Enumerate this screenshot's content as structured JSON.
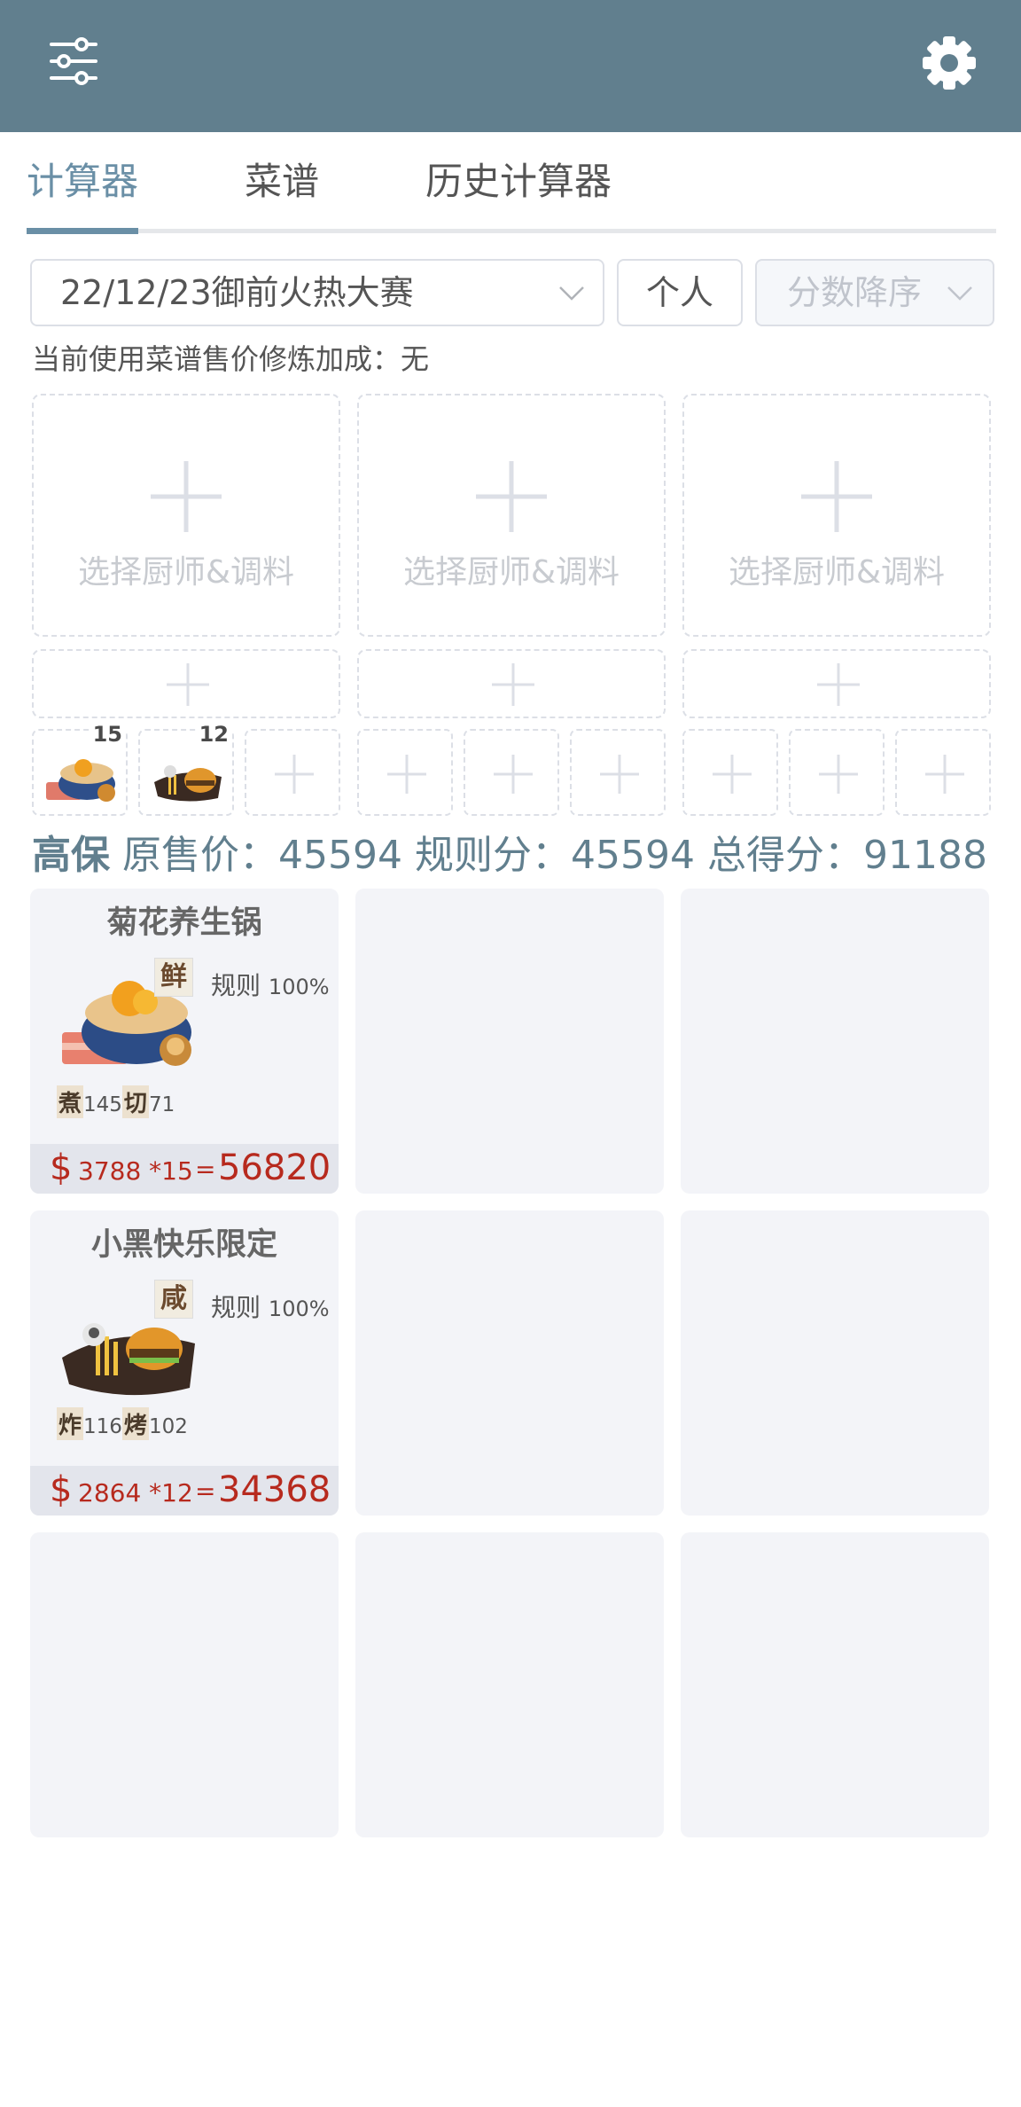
{
  "header": {
    "menu_icon": "sliders-icon",
    "settings_icon": "gear-icon"
  },
  "tabs": [
    {
      "label": "计算器",
      "active": true
    },
    {
      "label": "菜谱",
      "active": false
    },
    {
      "label": "历史计算器",
      "active": false
    }
  ],
  "controls": {
    "rule_select": "22/12/23御前火热大赛",
    "mode_button": "个人",
    "sort_select": "分数降序"
  },
  "bonus_text": "当前使用菜谱售价修炼加成：无",
  "chef_slot_label": "选择厨师&调料",
  "recipe_counts": {
    "r1": "15",
    "r2": "12"
  },
  "score": {
    "guarantee": "高保",
    "original_label": "原售价：",
    "original": "45594",
    "rule_label": "规则分：",
    "rule": "45594",
    "total_label": "总得分：",
    "total": "91188"
  },
  "cards": [
    {
      "name": "菊花养生锅",
      "condiment": "鲜",
      "rule_label": "规则",
      "rule_pct": "100%",
      "skill1": "煮",
      "skill1_val": "145",
      "skill2": "切",
      "skill2_val": "71",
      "currency": "$",
      "formula": "3788 *15",
      "eq": "=",
      "total": "56820"
    },
    {
      "name": "小黑快乐限定",
      "condiment": "咸",
      "rule_label": "规则",
      "rule_pct": "100%",
      "skill1": "炸",
      "skill1_val": "116",
      "skill2": "烤",
      "skill2_val": "102",
      "currency": "$",
      "formula": "2864 *12",
      "eq": "=",
      "total": "34368"
    }
  ],
  "colors": {
    "header": "#617f8e",
    "accent": "#6a8fa6",
    "price": "#b72a1e"
  }
}
